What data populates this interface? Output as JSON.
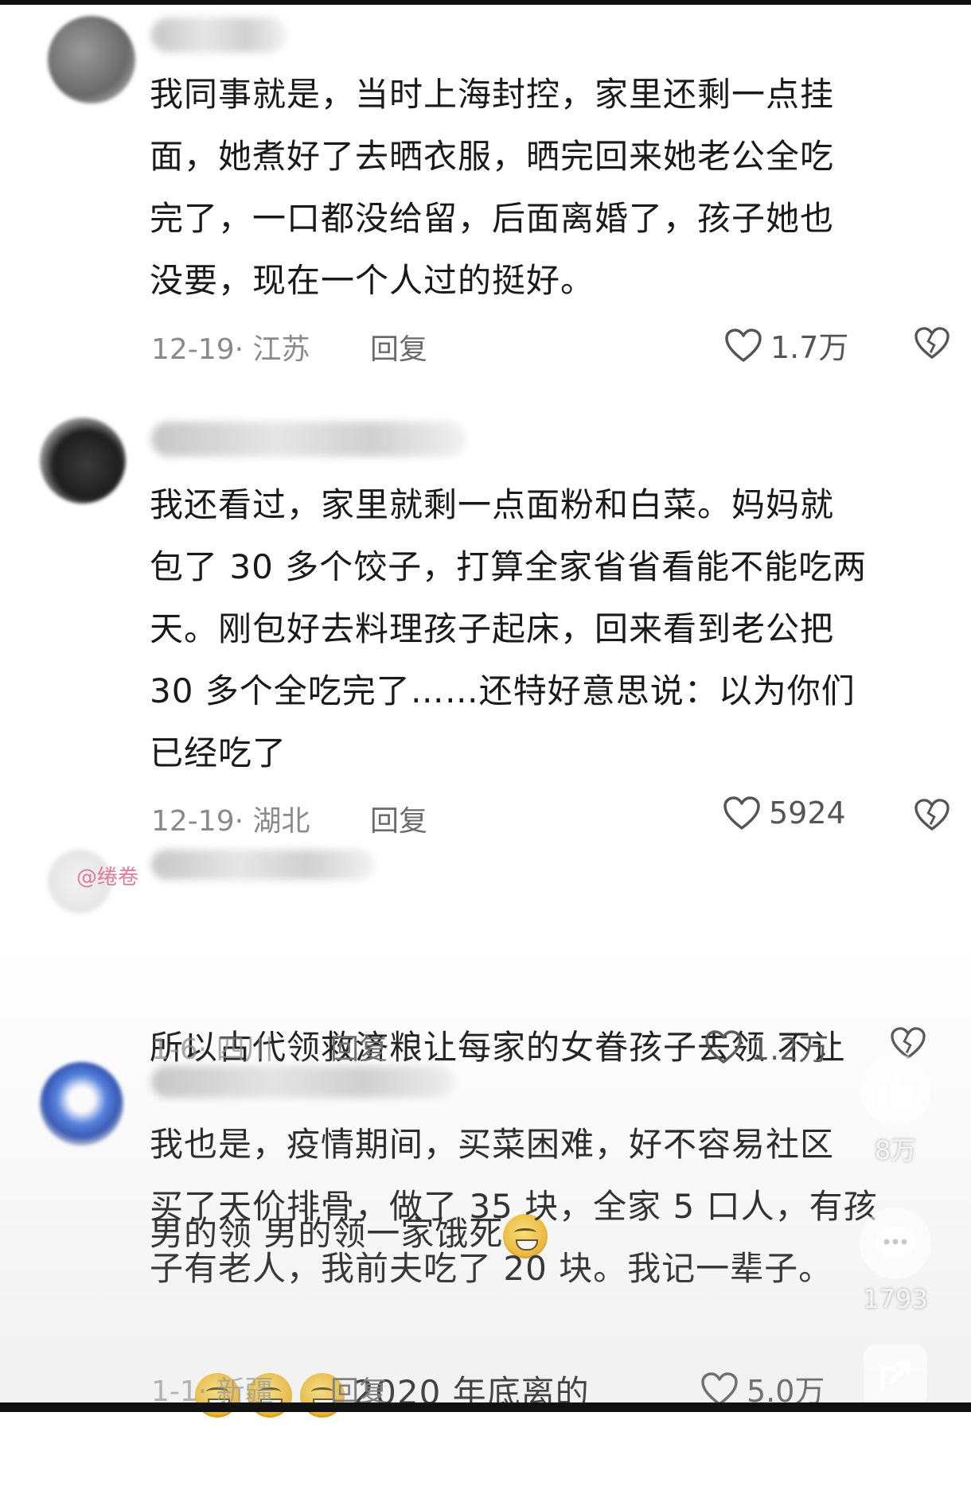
{
  "comments": [
    {
      "text": "我同事就是，当时上海封控，家里还剩一点挂\n面，她煮好了去晒衣服，晒完回来她老公全吃\n完了，一口都没给留，后面离婚了，孩子她也\n没要，现在一个人过的挺好。",
      "meta": "12-19· 江苏",
      "reply": "回复",
      "likes": "1.7万"
    },
    {
      "text": "我还看过，家里就剩一点面粉和白菜。妈妈就\n包了 30 多个饺子，打算全家省省看能不能吃两\n天。刚包好去料理孩子起床，回来看到老公把\n30 多个全吃完了……还特好意思说：以为你们\n已经吃了",
      "meta": "12-19· 湖北",
      "reply": "回复",
      "likes": "5924"
    },
    {
      "mention": "@绻卷",
      "text_line1": "所以古代领救济粮让每家的女眷孩子去领 不让",
      "text_line2": "男的领 男的领一家饿死",
      "meta": "1-6· 四川",
      "reply": "回复",
      "likes": "1.2万"
    },
    {
      "text": "我也是，疫情期间，买菜困难，好不容易社区\n买了天价排骨，做了 35 块，全家 5 口人，有孩\n子有老人，我前夫吃了 20 块。我记一辈子。",
      "text_tail": "2020 年底离的",
      "meta": "1-1· 新疆",
      "reply": "回复",
      "likes": "5.0万"
    }
  ],
  "side_actions": {
    "like_count": "8万",
    "comment_count": "1793"
  },
  "icons": {
    "like": "heart-outline-icon",
    "dislike": "broken-heart-icon",
    "side_like": "thumbs-up-icon",
    "side_comment": "comment-bubble-icon",
    "side_share": "share-icon",
    "emoji": "sweat-grin-emoji"
  }
}
